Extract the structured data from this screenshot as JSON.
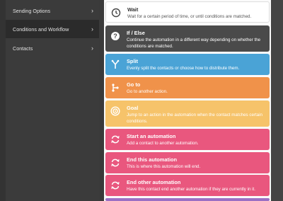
{
  "sidebar": {
    "items": [
      {
        "label": "Sending Options",
        "chevron": "›"
      },
      {
        "label": "Conditions and Workflow",
        "chevron": "›"
      },
      {
        "label": "Contacts",
        "chevron": "›"
      }
    ]
  },
  "actions": [
    {
      "title": "Wait",
      "desc": "Wait for a certain period of time, or until conditions are matched.",
      "icon": "clock-icon",
      "color": "#ffffff"
    },
    {
      "title": "If / Else",
      "desc": "Continue the automation in a different way depending on whether the conditions are matched.",
      "icon": "question-icon",
      "color": "#4a4a4a"
    },
    {
      "title": "Split",
      "desc": "Evenly split the contacts or choose how to distribute them.",
      "icon": "split-icon",
      "color": "#4aa3d6"
    },
    {
      "title": "Go to",
      "desc": "Go to another action.",
      "icon": "goto-icon",
      "color": "#f0924a"
    },
    {
      "title": "Goal",
      "desc": "Jump to an action in the automation when the contact matches certain conditions.",
      "icon": "goal-icon",
      "color": "#f6c36a"
    },
    {
      "title": "Start an automation",
      "desc": "Add a contact to another automation.",
      "icon": "cycle-icon",
      "color": "#e9577e"
    },
    {
      "title": "End this automation",
      "desc": "This is where this automation will end.",
      "icon": "cycle-icon",
      "color": "#e9577e"
    },
    {
      "title": "End other automation",
      "desc": "Have this contact end another automation if they are currently in it.",
      "icon": "cycle-icon",
      "color": "#e9577e"
    }
  ]
}
